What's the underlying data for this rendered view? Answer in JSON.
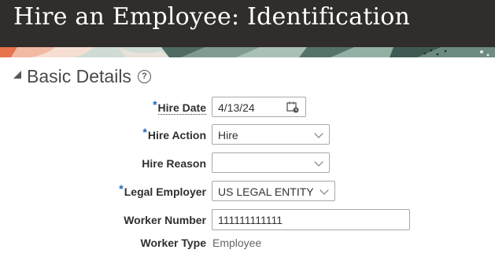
{
  "header": {
    "title": "Hire an Employee: Identification"
  },
  "section": {
    "title": "Basic Details",
    "help_icon": "question-circle-icon"
  },
  "fields": {
    "hire_date": {
      "label": "Hire Date",
      "required": "*",
      "value": "4/13/24",
      "icon": "calendar-icon"
    },
    "hire_action": {
      "label": "Hire Action",
      "required": "*",
      "value": "Hire",
      "icon": "chevron-down-icon"
    },
    "hire_reason": {
      "label": "Hire Reason",
      "value": "",
      "icon": "chevron-down-icon"
    },
    "legal_employer": {
      "label": "Legal Employer",
      "required": "*",
      "value": "US LEGAL ENTITY",
      "icon": "chevron-down-icon"
    },
    "worker_number": {
      "label": "Worker Number",
      "value": "111111111111"
    },
    "worker_type": {
      "label": "Worker Type",
      "value": "Employee"
    }
  },
  "colors": {
    "header_bg": "#312d2a",
    "required_asterisk": "#1c66b8"
  }
}
